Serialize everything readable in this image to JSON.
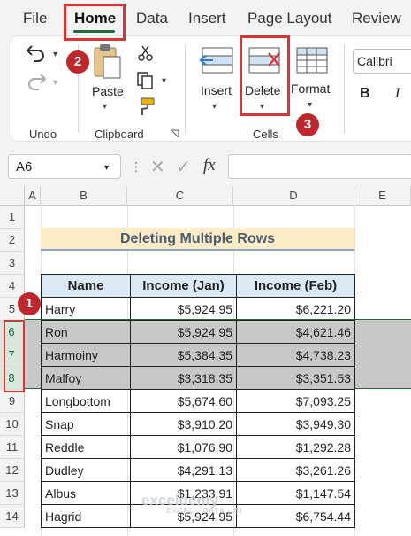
{
  "menu": {
    "tabs": [
      "File",
      "Home",
      "Data",
      "Insert",
      "Page Layout",
      "Review"
    ],
    "active_tab": "Home"
  },
  "ribbon": {
    "undo": {
      "group_label": "Undo"
    },
    "clipboard": {
      "paste_label": "Paste",
      "group_label": "Clipboard"
    },
    "cells": {
      "insert_label": "Insert",
      "delete_label": "Delete",
      "format_label": "Format",
      "group_label": "Cells"
    },
    "font": {
      "name": "Calibri",
      "bold_label": "B",
      "italic_label": "I"
    }
  },
  "formula_bar": {
    "name_box": "A6",
    "fx_label": "fx",
    "formula_value": ""
  },
  "grid": {
    "columns": [
      "A",
      "B",
      "C",
      "D",
      "E"
    ],
    "rows": [
      "1",
      "2",
      "3",
      "4",
      "5",
      "6",
      "7",
      "8",
      "9",
      "10",
      "11",
      "12",
      "13",
      "14"
    ],
    "selected_rows": [
      "6",
      "7",
      "8"
    ]
  },
  "sheet": {
    "title": "Deleting Multiple Rows",
    "headers": [
      "Name",
      "Income (Jan)",
      "Income (Feb)"
    ],
    "rows": [
      {
        "name": "Harry",
        "jan": "$5,924.95",
        "feb": "$6,221.20",
        "selected": false
      },
      {
        "name": "Ron",
        "jan": "$5,924.95",
        "feb": "$4,621.46",
        "selected": true
      },
      {
        "name": "Harmoiny",
        "jan": "$5,384.35",
        "feb": "$4,738.23",
        "selected": true
      },
      {
        "name": "Malfoy",
        "jan": "$3,318.35",
        "feb": "$3,351.53",
        "selected": true
      },
      {
        "name": "Longbottom",
        "jan": "$5,674.60",
        "feb": "$7,093.25",
        "selected": false
      },
      {
        "name": "Snap",
        "jan": "$3,910.20",
        "feb": "$3,949.30",
        "selected": false
      },
      {
        "name": "Reddle",
        "jan": "$1,076.90",
        "feb": "$1,292.28",
        "selected": false
      },
      {
        "name": "Dudley",
        "jan": "$4,291.13",
        "feb": "$3,261.26",
        "selected": false
      },
      {
        "name": "Albus",
        "jan": "$1,233.91",
        "feb": "$1,147.54",
        "selected": false
      },
      {
        "name": "Hagrid",
        "jan": "$5,924.95",
        "feb": "$6,754.44",
        "selected": false
      }
    ]
  },
  "annotations": {
    "step1": "1",
    "step2": "2",
    "step3": "3"
  },
  "watermark": {
    "brand": "exceldemy",
    "tagline": "EXCEL · DATA · BI"
  },
  "colors": {
    "accent_green": "#1e6b3b",
    "highlight_red": "#e03232",
    "badge_red": "#c0272d",
    "title_fill": "#fcebc4",
    "header_fill": "#dceaf6",
    "selection_gray": "#c8c8c8"
  }
}
